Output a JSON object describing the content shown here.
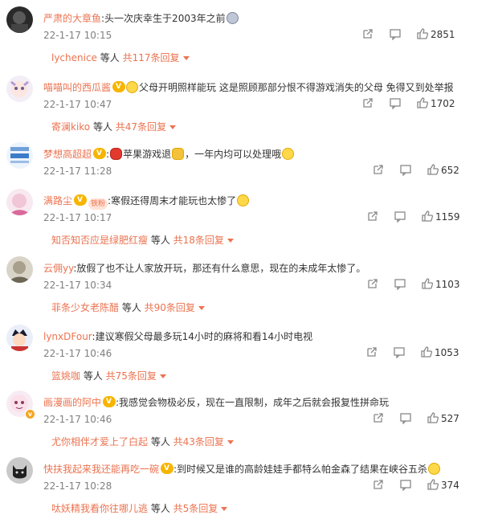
{
  "colors": {
    "accent": "#eb7350",
    "text": "#333333",
    "muted": "#808080"
  },
  "icons": {
    "share": "share-icon",
    "comment": "comment-icon",
    "like": "thumbs-up-icon"
  },
  "comments": [
    {
      "user": "严肃的大章鱼",
      "text": ":头一次庆幸生于2003年之前",
      "time": "22-1-17 10:15",
      "likes": "2851",
      "reply_user": "lychenice",
      "reply_mid": " 等人 ",
      "reply_count": "共117条回复"
    },
    {
      "user": "喵喵叫的西瓜酱",
      "text": "父母开明照样能玩 这是照顾那部分恨不得游戏消失的父母 免得又到处举报",
      "time": "22-1-17 10:47",
      "likes": "1702",
      "reply_user": "寄澜kiko",
      "reply_mid": " 等人 ",
      "reply_count": "共47条回复"
    },
    {
      "user": "梦想高超超",
      "text_a": "苹果游戏退",
      "text_b": "，一年内均可以处理哦",
      "time": "22-1-17 11:28",
      "likes": "652"
    },
    {
      "user": "满路尘",
      "fan_label": "铁粉",
      "text": ":寒假还得周末才能玩也太惨了",
      "time": "22-1-17 10:17",
      "likes": "1159",
      "reply_user": "知否知否应是绿肥红瘦",
      "reply_mid": " 等人 ",
      "reply_count": "共18条回复"
    },
    {
      "user": "云佣yy",
      "text": ":放假了也不让人家放开玩，那还有什么意思，现在的未成年太惨了。",
      "time": "22-1-17 10:34",
      "likes": "1103",
      "reply_user": "菲条少女老陈醋",
      "reply_mid": " 等人 ",
      "reply_count": "共90条回复"
    },
    {
      "user": "lynxDFour",
      "text": ":建议寒假父母最多玩14小时的麻将和看14小时电视",
      "time": "22-1-17 10:46",
      "likes": "1053",
      "reply_user": "篮姚咖",
      "reply_mid": " 等人 ",
      "reply_count": "共75条回复"
    },
    {
      "user": "画漫画的阿中",
      "text": ":我感觉会物极必反，现在一直限制，成年之后就会报复性拼命玩",
      "time": "22-1-17 10:46",
      "likes": "527",
      "reply_user": "尤你相伴才爱上了白起",
      "reply_mid": " 等人 ",
      "reply_count": "共43条回复"
    },
    {
      "user": "快扶我起来我还能再吃一碗",
      "text": ":到时候又是谁的高龄娃娃手都特么帕金森了结果在峡谷五杀",
      "time": "22-1-17 10:28",
      "likes": "374",
      "reply_user": "呔妖精我看你往哪儿逃",
      "reply_mid": " 等人 ",
      "reply_count": "共5条回复"
    }
  ]
}
